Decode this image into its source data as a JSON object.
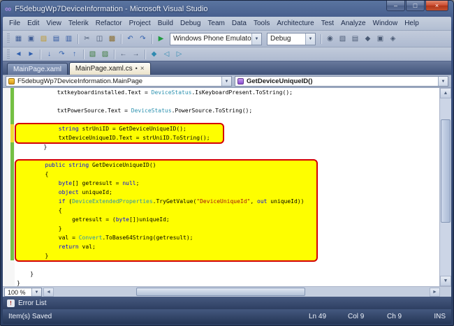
{
  "window": {
    "title": "F5debugWp7DeviceInformation - Microsoft Visual Studio",
    "controls": [
      {
        "name": "minimize-button",
        "glyph": "–"
      },
      {
        "name": "maximize-button",
        "glyph": "□"
      },
      {
        "name": "close-button",
        "glyph": "×"
      }
    ]
  },
  "icons": {
    "logo": "∞",
    "chevron_down": "▼",
    "close": "×",
    "modified": "•",
    "scroll_up": "▲",
    "scroll_down": "▼",
    "scroll_left": "◄",
    "scroll_right": "►",
    "error_list": "!"
  },
  "menu": [
    "File",
    "Edit",
    "View",
    "Telerik",
    "Refactor",
    "Project",
    "Build",
    "Debug",
    "Team",
    "Data",
    "Tools",
    "Architecture",
    "Test",
    "Analyze",
    "Window",
    "Help"
  ],
  "toolbars": {
    "row1": [
      {
        "type": "icon",
        "name": "new-project",
        "glyph": "▦",
        "color": "#3f5d95"
      },
      {
        "type": "icon",
        "name": "add-item",
        "glyph": "▣",
        "color": "#3f5d95"
      },
      {
        "type": "icon",
        "name": "open-file",
        "glyph": "▨",
        "color": "#bf9a32"
      },
      {
        "type": "icon",
        "name": "save",
        "glyph": "▤",
        "color": "#2e56a0"
      },
      {
        "type": "icon",
        "name": "save-all",
        "glyph": "▥",
        "color": "#2e56a0"
      },
      {
        "type": "sep"
      },
      {
        "type": "icon",
        "name": "cut",
        "glyph": "✂",
        "color": "#4a5a74"
      },
      {
        "type": "icon",
        "name": "copy",
        "glyph": "◫",
        "color": "#4a5a74"
      },
      {
        "type": "icon",
        "name": "paste",
        "glyph": "▩",
        "color": "#8a6d2e"
      },
      {
        "type": "sep"
      },
      {
        "type": "icon",
        "name": "undo",
        "glyph": "↶",
        "color": "#2f5fae"
      },
      {
        "type": "icon",
        "name": "redo",
        "glyph": "↷",
        "color": "#2f5fae"
      },
      {
        "type": "sep"
      },
      {
        "type": "icon",
        "name": "start-debugging",
        "glyph": "▶",
        "color": "#1f9a3f"
      },
      {
        "type": "combo",
        "name": "debug-target-dropdown",
        "value": "Windows Phone Emulator",
        "width": 132
      },
      {
        "type": "combo",
        "name": "solution-configurations-dropdown",
        "value": "Debug",
        "width": 70
      },
      {
        "type": "sep"
      },
      {
        "type": "icon",
        "name": "find-in-files",
        "glyph": "◉",
        "color": "#4a5a74"
      },
      {
        "type": "icon",
        "name": "solution-explorer",
        "glyph": "▧",
        "color": "#4a5a74"
      },
      {
        "type": "icon",
        "name": "properties-window",
        "glyph": "▤",
        "color": "#4a5a74"
      },
      {
        "type": "icon",
        "name": "object-browser",
        "glyph": "◆",
        "color": "#4a5a74"
      },
      {
        "type": "icon",
        "name": "toolbox",
        "glyph": "▣",
        "color": "#4a5a74"
      },
      {
        "type": "icon",
        "name": "extension-manager",
        "glyph": "◈",
        "color": "#4a5a74"
      }
    ],
    "row2": [
      {
        "type": "icon",
        "name": "navigate-backward",
        "glyph": "◄",
        "color": "#2f5fae"
      },
      {
        "type": "icon",
        "name": "navigate-forward",
        "glyph": "►",
        "color": "#2f5fae"
      },
      {
        "type": "sep"
      },
      {
        "type": "icon",
        "name": "step-into",
        "glyph": "↓",
        "color": "#2f5fae"
      },
      {
        "type": "icon",
        "name": "step-over",
        "glyph": "↷",
        "color": "#2f5fae"
      },
      {
        "type": "icon",
        "name": "step-out",
        "glyph": "↑",
        "color": "#2f5fae"
      },
      {
        "type": "sep"
      },
      {
        "type": "icon",
        "name": "comment-selection",
        "glyph": "▧",
        "color": "#3b7a3b"
      },
      {
        "type": "icon",
        "name": "uncomment-selection",
        "glyph": "▨",
        "color": "#3b7a3b"
      },
      {
        "type": "sep"
      },
      {
        "type": "icon",
        "name": "decrease-indent",
        "glyph": "←",
        "color": "#4a5a74"
      },
      {
        "type": "icon",
        "name": "increase-indent",
        "glyph": "→",
        "color": "#4a5a74"
      },
      {
        "type": "sep"
      },
      {
        "type": "icon",
        "name": "toggle-bookmark",
        "glyph": "◆",
        "color": "#2f8ab0"
      },
      {
        "type": "icon",
        "name": "previous-bookmark",
        "glyph": "◁",
        "color": "#2f8ab0"
      },
      {
        "type": "icon",
        "name": "next-bookmark",
        "glyph": "▷",
        "color": "#2f8ab0"
      }
    ]
  },
  "tabs": [
    {
      "label": "MainPage.xaml",
      "active": false,
      "modified": false
    },
    {
      "label": "MainPage.xaml.cs",
      "active": true,
      "modified": true
    }
  ],
  "navbar": {
    "type": "F5debugWp7DeviceInformation.MainPage",
    "member": "GetDeviceUniqueID()"
  },
  "editor": {
    "zoom": "100 %",
    "sections": [
      {
        "hl": false,
        "lines": [
          {
            "m": "g",
            "t": [
              [
                "            txtkeyboardinstalled.Text = ",
                "p"
              ],
              [
                "DeviceStatus",
                "t"
              ],
              [
                ".IsKeyboardPresent.ToString();",
                "p"
              ]
            ]
          },
          {
            "m": "g",
            "t": []
          },
          {
            "m": "g",
            "t": [
              [
                "            txtPowerSource.Text = ",
                "p"
              ],
              [
                "DeviceStatus",
                "t"
              ],
              [
                ".PowerSource.ToString();",
                "p"
              ]
            ]
          },
          {
            "m": "g",
            "t": []
          }
        ]
      },
      {
        "hl": true,
        "lines": [
          {
            "m": "y",
            "t": [
              [
                "            ",
                "p"
              ],
              [
                "string",
                "k"
              ],
              [
                " strUniID = GetDeviceUniqueID();",
                "p"
              ]
            ]
          },
          {
            "m": "y",
            "t": [
              [
                "            txtDeviceUniqueID.Text = strUniID.ToString();",
                "p"
              ]
            ]
          }
        ]
      },
      {
        "hl": false,
        "lines": [
          {
            "m": "g",
            "t": [
              [
                "        }",
                "p"
              ]
            ]
          },
          {
            "m": "g",
            "t": []
          }
        ]
      },
      {
        "hl": true,
        "lines": [
          {
            "m": "g",
            "t": [
              [
                "        ",
                "p"
              ],
              [
                "public",
                "k"
              ],
              [
                " ",
                "p"
              ],
              [
                "string",
                "k"
              ],
              [
                " GetDeviceUniqueID()",
                "p"
              ]
            ]
          },
          {
            "m": "g",
            "t": [
              [
                "        {",
                "p"
              ]
            ]
          },
          {
            "m": "g",
            "t": [
              [
                "            ",
                "p"
              ],
              [
                "byte",
                "k"
              ],
              [
                "[] getresult = ",
                "p"
              ],
              [
                "null",
                "k"
              ],
              [
                ";",
                "p"
              ]
            ]
          },
          {
            "m": "g",
            "t": [
              [
                "            ",
                "p"
              ],
              [
                "object",
                "k"
              ],
              [
                " uniqueId;",
                "p"
              ]
            ]
          },
          {
            "m": "g",
            "t": [
              [
                "            ",
                "p"
              ],
              [
                "if",
                "k"
              ],
              [
                " (",
                "p"
              ],
              [
                "DeviceExtendedProperties",
                "t"
              ],
              [
                ".TryGetValue(",
                "p"
              ],
              [
                "\"DeviceUniqueId\"",
                "s"
              ],
              [
                ", ",
                "p"
              ],
              [
                "out",
                "k"
              ],
              [
                " uniqueId))",
                "p"
              ]
            ]
          },
          {
            "m": "g",
            "t": [
              [
                "            {",
                "p"
              ]
            ]
          },
          {
            "m": "g",
            "t": [
              [
                "                getresult = (",
                "p"
              ],
              [
                "byte",
                "k"
              ],
              [
                "[])uniqueId;",
                "p"
              ]
            ]
          },
          {
            "m": "g",
            "t": [
              [
                "            }",
                "p"
              ]
            ]
          },
          {
            "m": "g",
            "t": [
              [
                "            val = ",
                "p"
              ],
              [
                "Convert",
                "t"
              ],
              [
                ".ToBase64String(getresult);",
                "p"
              ]
            ]
          },
          {
            "m": "g",
            "t": [
              [
                "            ",
                "p"
              ],
              [
                "return",
                "k"
              ],
              [
                " val;",
                "p"
              ]
            ]
          },
          {
            "m": "g",
            "t": [
              [
                "        }",
                "p"
              ]
            ]
          }
        ]
      },
      {
        "hl": false,
        "lines": [
          {
            "t": []
          },
          {
            "t": [
              [
                "    }",
                "p"
              ]
            ]
          },
          {
            "t": [
              [
                "}",
                "p"
              ]
            ]
          }
        ]
      }
    ]
  },
  "panels": {
    "error_list": "Error List"
  },
  "statusbar": {
    "message": "Item(s) Saved",
    "ln": "Ln 49",
    "col": "Col 9",
    "ch": "Ch 9",
    "mode": "INS"
  }
}
